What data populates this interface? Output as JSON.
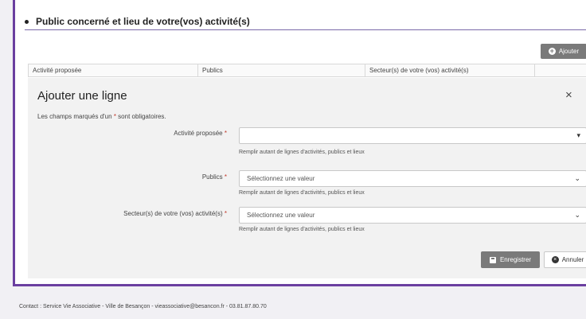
{
  "section": {
    "title": "Public concerné et lieu de votre(vos) activité(s)"
  },
  "toolbar": {
    "add_label": "Ajouter"
  },
  "table": {
    "columns": [
      "Activité proposée",
      "Publics",
      "Secteur(s) de votre (vos) activité(s)",
      ""
    ]
  },
  "modal": {
    "title": "Ajouter une ligne",
    "close_symbol": "×",
    "required_note_prefix": "Les champs marqués d'un",
    "required_star": "*",
    "required_note_suffix": "sont obligatoires.",
    "fields": {
      "activite": {
        "label": "Activité proposée",
        "value": "",
        "help": "Remplir autant de lignes d'activités, publics et lieux"
      },
      "publics": {
        "label": "Publics",
        "value": "Sélectionnez une valeur",
        "help": "Remplir autant de lignes d'activités, publics et lieux"
      },
      "secteur": {
        "label": "Secteur(s) de votre (vos) activité(s)",
        "value": "Sélectionnez une valeur",
        "help": "Remplir autant de lignes d'activités, publics et lieux"
      }
    },
    "save_label": "Enregistrer",
    "cancel_label": "Annuler"
  },
  "footer": {
    "text": "Contact : Service Vie Associative - Ville de Besançon - vieassociative@besancon.fr - 03.81.87.80.70"
  },
  "colors": {
    "accent": "#6b3fa0",
    "required": "#c0392b",
    "button_gray": "#7a7a7a"
  }
}
